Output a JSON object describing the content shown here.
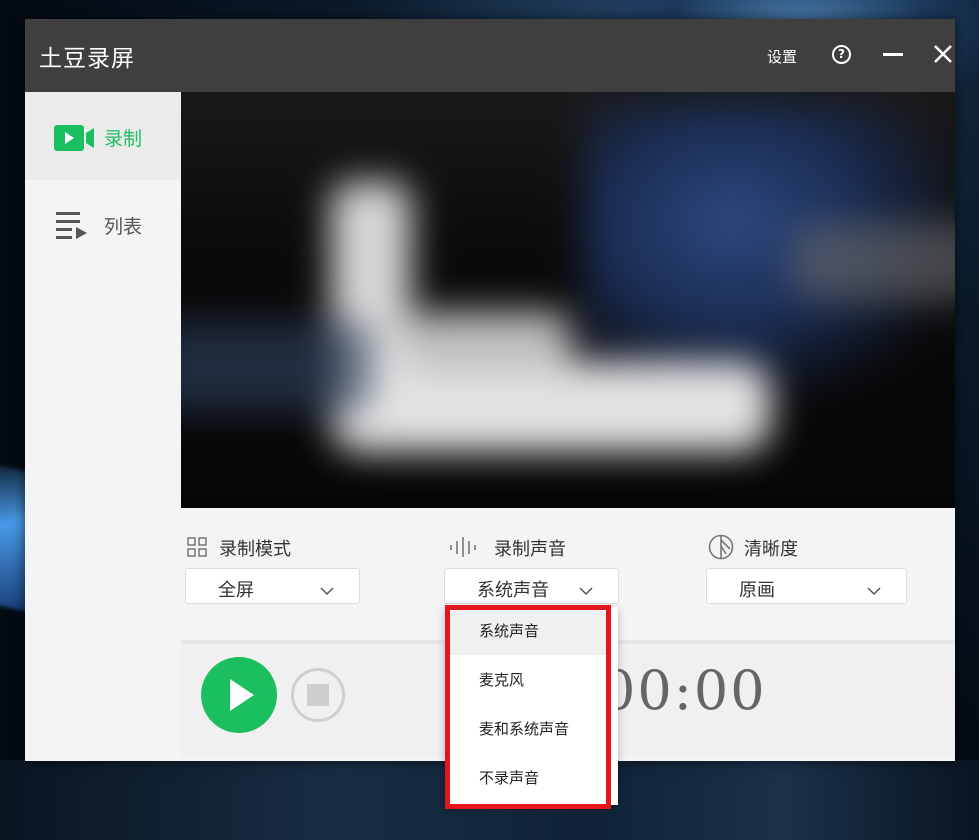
{
  "window": {
    "title": "土豆录屏",
    "settings_label": "设置"
  },
  "sidebar": {
    "items": [
      {
        "label": "录制",
        "icon": "video-record-icon",
        "active": true
      },
      {
        "label": "列表",
        "icon": "playlist-icon",
        "active": false
      }
    ]
  },
  "controls": {
    "mode": {
      "label": "录制模式",
      "icon": "grid-icon",
      "value": "全屏"
    },
    "audio": {
      "label": "录制声音",
      "icon": "soundwave-icon",
      "value": "系统声音"
    },
    "quality": {
      "label": "清晰度",
      "icon": "clarity-icon",
      "value": "原画"
    }
  },
  "audio_dropdown": {
    "options": [
      "系统声音",
      "麦克风",
      "麦和系统声音",
      "不录声音"
    ],
    "selected_index": 0
  },
  "timer": {
    "text": "00:00"
  },
  "colors": {
    "accent": "#1cbf60",
    "titlebar": "#3f3f3f",
    "highlight": "#e5161b"
  }
}
